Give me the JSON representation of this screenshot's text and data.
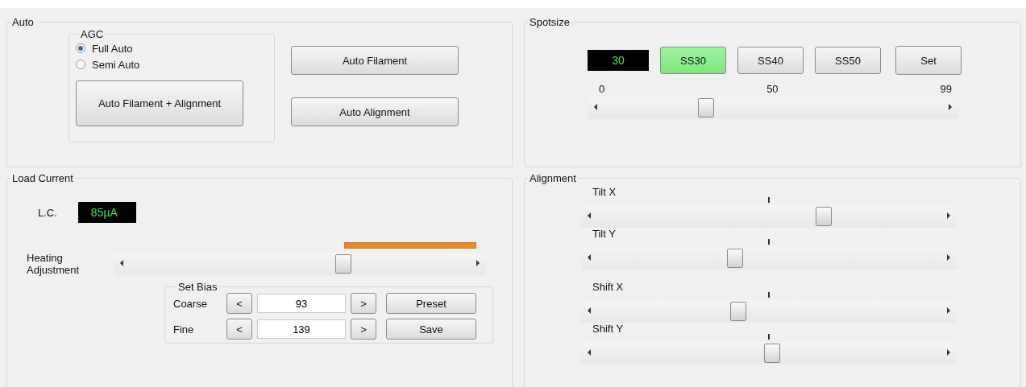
{
  "auto": {
    "title": "Auto",
    "agc": {
      "title": "AGC",
      "options": [
        {
          "label": "Full Auto",
          "selected": true
        },
        {
          "label": "Semi Auto",
          "selected": false
        }
      ],
      "button": "Auto Filament + Alignment"
    },
    "buttons": [
      "Auto Filament",
      "Auto Alignment"
    ]
  },
  "spotsize": {
    "title": "Spotsize",
    "display": "30",
    "presets": [
      {
        "label": "SS30",
        "selected": true
      },
      {
        "label": "SS40",
        "selected": false
      },
      {
        "label": "SS50",
        "selected": false
      }
    ],
    "set_button": "Set",
    "scale": [
      "0",
      "50",
      "99"
    ],
    "slider": {
      "level": 0.3
    }
  },
  "load_current": {
    "title": "Load Current",
    "lc_label": "L.C.",
    "lc_value": "85µA",
    "heating": {
      "label": "Heating Adjustment",
      "level": 0.63
    },
    "set_bias": {
      "title": "Set Bias",
      "rows": [
        {
          "label": "Coarse",
          "dec": "<",
          "value": "93",
          "inc": ">",
          "button": "Preset"
        },
        {
          "label": "Fine",
          "dec": "<",
          "value": "139",
          "inc": ">",
          "button": "Save"
        }
      ]
    }
  },
  "alignment": {
    "title": "Alignment",
    "sliders": [
      {
        "label": "Tilt X",
        "level": 0.66
      },
      {
        "label": "Tilt Y",
        "level": 0.4
      },
      {
        "label": "Shift X",
        "level": 0.41
      },
      {
        "label": "Shift Y",
        "level": 0.51
      }
    ]
  }
}
